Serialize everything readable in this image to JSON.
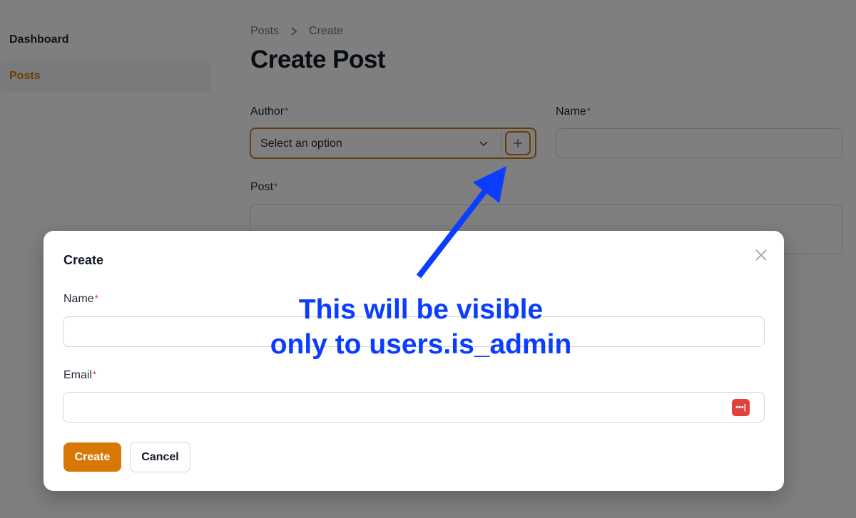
{
  "sidebar": {
    "items": [
      {
        "label": "Dashboard",
        "active": false
      },
      {
        "label": "Posts",
        "active": true
      }
    ]
  },
  "breadcrumb": {
    "items": [
      "Posts",
      "Create"
    ]
  },
  "page": {
    "title": "Create Post"
  },
  "form": {
    "author": {
      "label": "Author",
      "required_mark": "*",
      "value": "Select an option",
      "add_icon": "plus-icon"
    },
    "name": {
      "label": "Name",
      "required_mark": "*",
      "value": ""
    },
    "post": {
      "label": "Post",
      "required_mark": "*",
      "value": ""
    }
  },
  "modal": {
    "title": "Create",
    "fields": {
      "name": {
        "label": "Name",
        "required_mark": "*",
        "value": ""
      },
      "email": {
        "label": "Email",
        "required_mark": "*",
        "value": "",
        "icon": "password-manager-icon",
        "icon_text": "•••|"
      }
    },
    "buttons": {
      "create": "Create",
      "cancel": "Cancel"
    }
  },
  "annotation": {
    "line1": "This will be visible",
    "line2": "only to users.is_admin"
  },
  "colors": {
    "accent": "#d97706",
    "annotation": "#0a3dff",
    "required": "#dc2626"
  }
}
